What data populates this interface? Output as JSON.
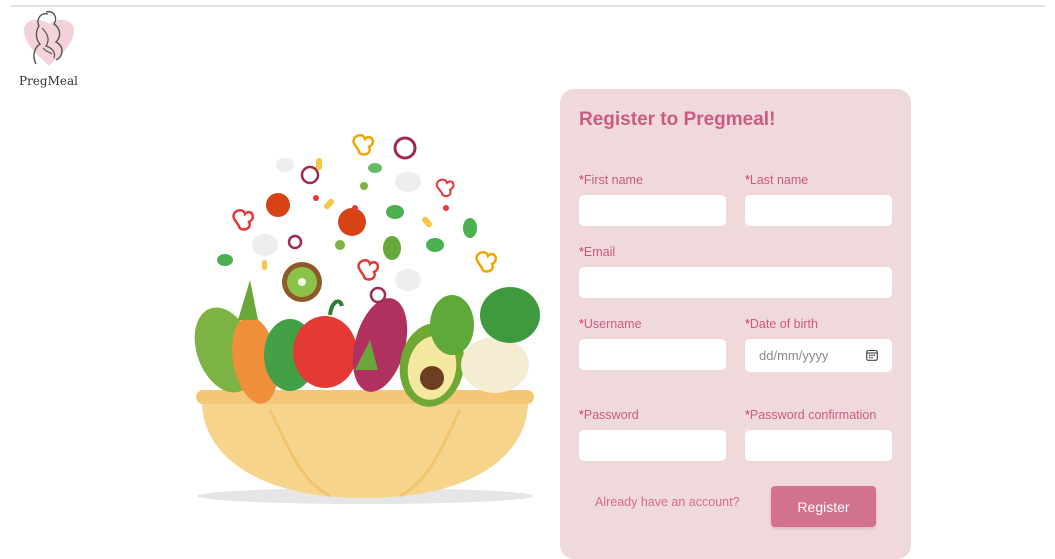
{
  "brand": {
    "name": "PregMeal"
  },
  "form": {
    "title": "Register to Pregmeal!",
    "required_marker": "*",
    "fields": {
      "first_name": {
        "label": "First name",
        "value": ""
      },
      "last_name": {
        "label": "Last name",
        "value": ""
      },
      "email": {
        "label": "Email",
        "value": ""
      },
      "username": {
        "label": "Username",
        "value": ""
      },
      "date_of_birth": {
        "label": "Date of birth",
        "placeholder": "dd/mm/yyyy"
      },
      "password": {
        "label": "Password",
        "value": ""
      },
      "password_confirmation": {
        "label": "Password confirmation",
        "value": ""
      }
    },
    "login_link": "Already have an account?",
    "submit_label": "Register"
  },
  "colors": {
    "accent": "#cc5a84",
    "card_bg": "#efd9db",
    "button_bg": "#d3728e"
  },
  "icons": [
    "pregnant-woman-logo-icon",
    "calendar-icon"
  ]
}
